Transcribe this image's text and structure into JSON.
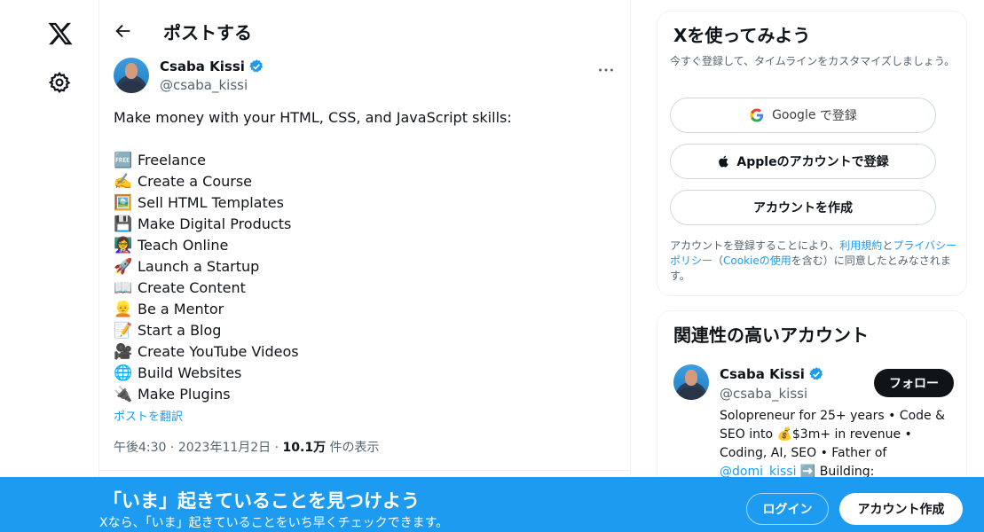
{
  "header": {
    "title": "ポストする"
  },
  "post": {
    "author_name": "Csaba Kissi",
    "author_handle": "@csaba_kissi",
    "intro": "Make money with your HTML, CSS, and JavaScript skills:",
    "items": [
      {
        "emoji": "🆓",
        "text": "Freelance"
      },
      {
        "emoji": "✍️",
        "text": "Create a Course"
      },
      {
        "emoji": "🖼️",
        "text": "Sell HTML Templates"
      },
      {
        "emoji": "💾",
        "text": "Make Digital Products"
      },
      {
        "emoji": "👩‍🏫",
        "text": "Teach Online"
      },
      {
        "emoji": "🚀",
        "text": "Launch a Startup"
      },
      {
        "emoji": "📖",
        "text": "Create Content"
      },
      {
        "emoji": "👱",
        "text": "Be a Mentor"
      },
      {
        "emoji": "📝",
        "text": "Start a Blog"
      },
      {
        "emoji": "🎥",
        "text": "Create YouTube Videos"
      },
      {
        "emoji": "🌐",
        "text": "Build Websites"
      },
      {
        "emoji": "🔌",
        "text": "Make Plugins"
      }
    ],
    "translate_label": "ポストを翻訳",
    "time": "午後4:30",
    "date": "2023年11月2日",
    "views_count": "10.1万",
    "views_label": "件の表示",
    "separator": "·"
  },
  "signup_card": {
    "title": "Xを使ってみよう",
    "subtitle": "今すぐ登録して、タイムラインをカスタマイズしましょう。",
    "google_brand": "Google",
    "google_label": "で登録",
    "apple_label": "Appleのアカウントで登録",
    "create_label": "アカウントを作成",
    "terms_prefix": "アカウントを登録することにより、",
    "terms_link": "利用規約",
    "terms_and": "と",
    "privacy_link": "プライバシーポリシー",
    "paren_open": "（",
    "cookie_link": "Cookieの使用",
    "terms_suffix": "を含む）に同意したとみなされます。"
  },
  "related": {
    "title": "関連性の高いアカウント",
    "name": "Csaba Kissi",
    "handle": "@csaba_kissi",
    "follow_label": "フォロー",
    "bio_text": "Solopreneur for 25+ years • Code & SEO into 💰$3m+ in revenue • Coding, AI, SEO • Father of",
    "bio_mention": "@domi_kissi",
    "bio_tail": "➡️ Building:"
  },
  "banner": {
    "title": "「いま」起きていることを見つけよう",
    "subtitle": "Xなら、「いま」起きていることをいち早くチェックできます。",
    "login_label": "ログイン",
    "signup_label": "アカウント作成"
  },
  "colors": {
    "accent": "#1d9bf0",
    "text": "#0f1419",
    "muted": "#536471"
  },
  "icons": [
    "x-logo-icon",
    "gear-icon",
    "back-arrow-icon",
    "verified-badge-icon",
    "more-icon",
    "google-icon",
    "apple-icon"
  ]
}
